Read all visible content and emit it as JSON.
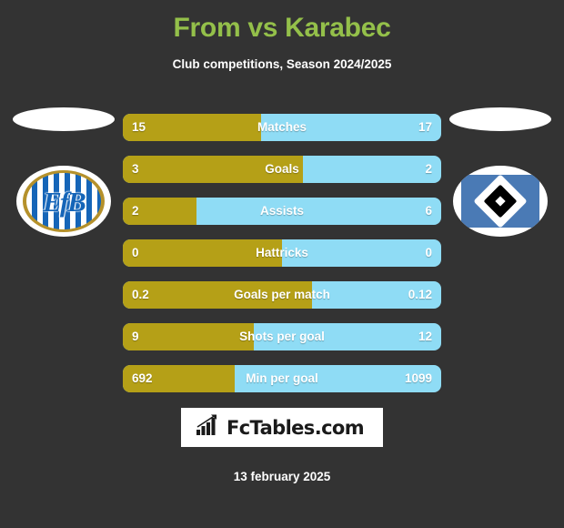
{
  "header": {
    "title": "From vs Karabec",
    "subtitle": "Club competitions, Season 2024/2025",
    "title_color": "#94c04a"
  },
  "teams": {
    "home": {
      "crest_name": "esbjerg-fb-crest",
      "monogram": "EfB"
    },
    "away": {
      "crest_name": "hamburger-sv-crest",
      "monogram": ""
    }
  },
  "colors": {
    "home_bar": "#b5a017",
    "away_bar": "#8fdcf5",
    "background": "#333333",
    "text": "#ffffff"
  },
  "chart_data": {
    "type": "bar",
    "title": "From vs Karabec",
    "subtitle": "Club competitions, Season 2024/2025",
    "orientation": "horizontal-diverging",
    "legend": [
      "From",
      "Karabec"
    ],
    "categories": [
      "Matches",
      "Goals",
      "Assists",
      "Hattricks",
      "Goals per match",
      "Shots per goal",
      "Min per goal"
    ],
    "series": [
      {
        "name": "From",
        "color": "#b5a017",
        "values": [
          15,
          3,
          2,
          0,
          0.2,
          9,
          692
        ],
        "labels": [
          "15",
          "3",
          "2",
          "0",
          "0.2",
          "9",
          "692"
        ]
      },
      {
        "name": "Karabec",
        "color": "#8fdcf5",
        "values": [
          17,
          2,
          6,
          0,
          0.12,
          12,
          1099
        ],
        "labels": [
          "17",
          "2",
          "6",
          "0",
          "0.12",
          "12",
          "1099"
        ]
      }
    ],
    "home_fill_percent": [
      43.4,
      56.6,
      23.0,
      50.0,
      59.5,
      41.0,
      35.0
    ]
  },
  "rows": [
    {
      "label": "Matches",
      "home": "15",
      "away": "17",
      "fill": 43.4
    },
    {
      "label": "Goals",
      "home": "3",
      "away": "2",
      "fill": 56.6
    },
    {
      "label": "Assists",
      "home": "2",
      "away": "6",
      "fill": 23.0
    },
    {
      "label": "Hattricks",
      "home": "0",
      "away": "0",
      "fill": 50.0
    },
    {
      "label": "Goals per match",
      "home": "0.2",
      "away": "0.12",
      "fill": 59.5
    },
    {
      "label": "Shots per goal",
      "home": "9",
      "away": "12",
      "fill": 41.0
    },
    {
      "label": "Min per goal",
      "home": "692",
      "away": "1099",
      "fill": 35.0
    }
  ],
  "footer": {
    "logo_text": "FcTables.com",
    "logo_icon": "bar-chart-arrow-icon",
    "date": "13 february 2025"
  }
}
